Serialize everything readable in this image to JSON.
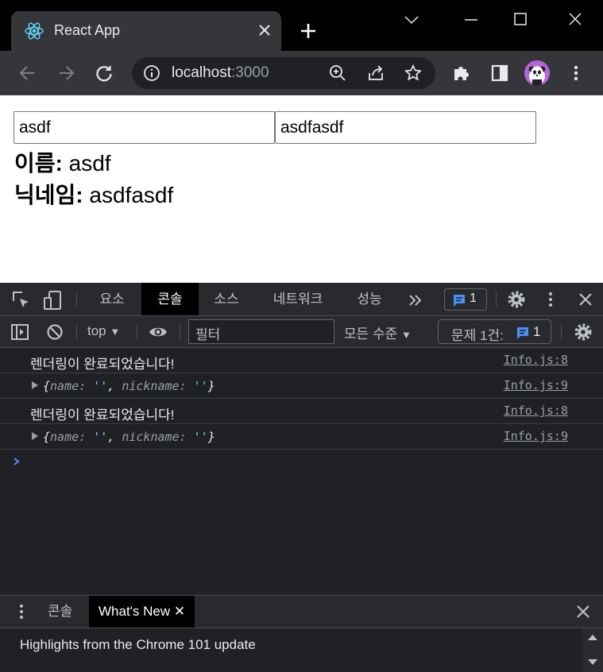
{
  "browser": {
    "tab_title": "React App",
    "url_host": "localhost",
    "url_port": ":3000"
  },
  "page": {
    "name_input_value": "asdf",
    "nickname_input_value": "asdfasdf",
    "name_label": "이름:",
    "name_value": "asdf",
    "nickname_label": "닉네임:",
    "nickname_value": "asdfasdf"
  },
  "devtools": {
    "tabs": [
      "요소",
      "콘솔",
      "소스",
      "네트워크",
      "성능"
    ],
    "active_tab": "콘솔",
    "message_badge_count": "1",
    "context": "top",
    "filter_placeholder": "필터",
    "levels": "모든 수준",
    "issues_label": "문제 1건:",
    "issues_count": "1",
    "logs": [
      {
        "type": "text",
        "message": "렌더링이 완료되었습니다!",
        "source": "Info.js:8"
      },
      {
        "type": "object",
        "key1": "name",
        "val1": "''",
        "key2": "nickname",
        "val2": "''",
        "source": "Info.js:9"
      },
      {
        "type": "text",
        "message": "렌더링이 완료되었습니다!",
        "source": "Info.js:8"
      },
      {
        "type": "object",
        "key1": "name",
        "val1": "''",
        "key2": "nickname",
        "val2": "''",
        "source": "Info.js:9"
      }
    ],
    "drawer_tabs": [
      "콘솔",
      "What's New"
    ],
    "whats_new_text": "Highlights from the Chrome 101 update"
  },
  "colors": {
    "accent_blue": "#4d8ff7",
    "string_cyan": "#5cd5fb",
    "avatar_purple": "#b565d9"
  }
}
